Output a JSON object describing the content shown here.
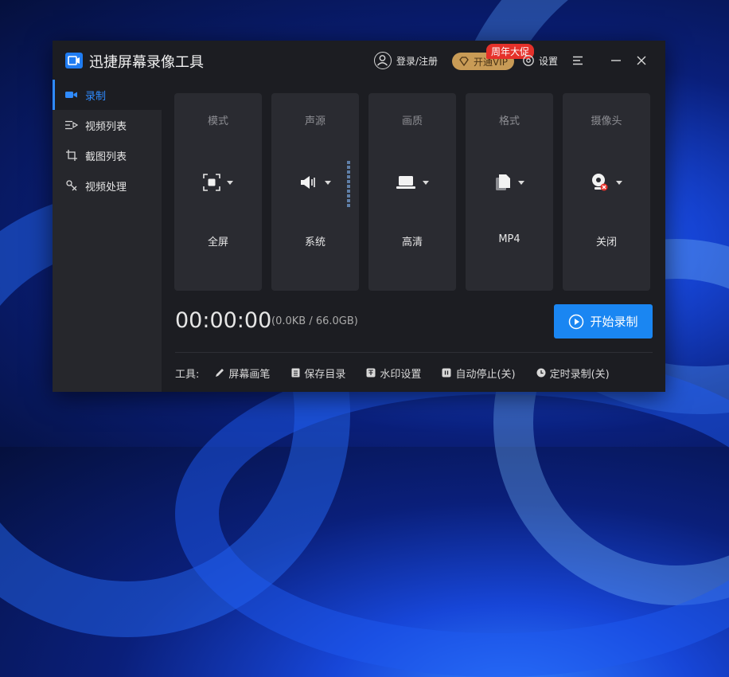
{
  "app": {
    "title": "迅捷屏幕录像工具"
  },
  "header": {
    "login_label": "登录/注册",
    "vip_label": "开通VIP",
    "promo_badge": "周年大促",
    "settings_label": "设置"
  },
  "sidebar": {
    "items": [
      {
        "label": "录制",
        "icon": "video-camera-icon",
        "active": true
      },
      {
        "label": "视频列表",
        "icon": "video-list-icon"
      },
      {
        "label": "截图列表",
        "icon": "screenshot-list-icon"
      },
      {
        "label": "视频处理",
        "icon": "video-process-icon"
      }
    ]
  },
  "cards": [
    {
      "caption": "模式",
      "value": "全屏",
      "icon": "fullscreen-icon"
    },
    {
      "caption": "声源",
      "value": "系统",
      "icon": "speaker-icon"
    },
    {
      "caption": "画质",
      "value": "高清",
      "icon": "laptop-icon"
    },
    {
      "caption": "格式",
      "value": "MP4",
      "icon": "file-icon"
    },
    {
      "caption": "摄像头",
      "value": "关闭",
      "icon": "webcam-off-icon"
    }
  ],
  "status": {
    "timer": "00:00:00",
    "size": "(0.0KB / 66.0GB)"
  },
  "record_button": {
    "label": "开始录制"
  },
  "tools": {
    "label": "工具:",
    "items": [
      {
        "label": "屏幕画笔",
        "icon": "pen-icon"
      },
      {
        "label": "保存目录",
        "icon": "folder-icon"
      },
      {
        "label": "水印设置",
        "icon": "watermark-icon"
      },
      {
        "label": "自动停止(关)",
        "icon": "auto-stop-icon"
      },
      {
        "label": "定时录制(关)",
        "icon": "clock-icon"
      }
    ]
  },
  "colors": {
    "accent": "#1a86f2",
    "vip": "#c89b56",
    "promo": "#e5312a",
    "window_bg": "#1c1d22",
    "card_bg": "#2a2b31"
  }
}
